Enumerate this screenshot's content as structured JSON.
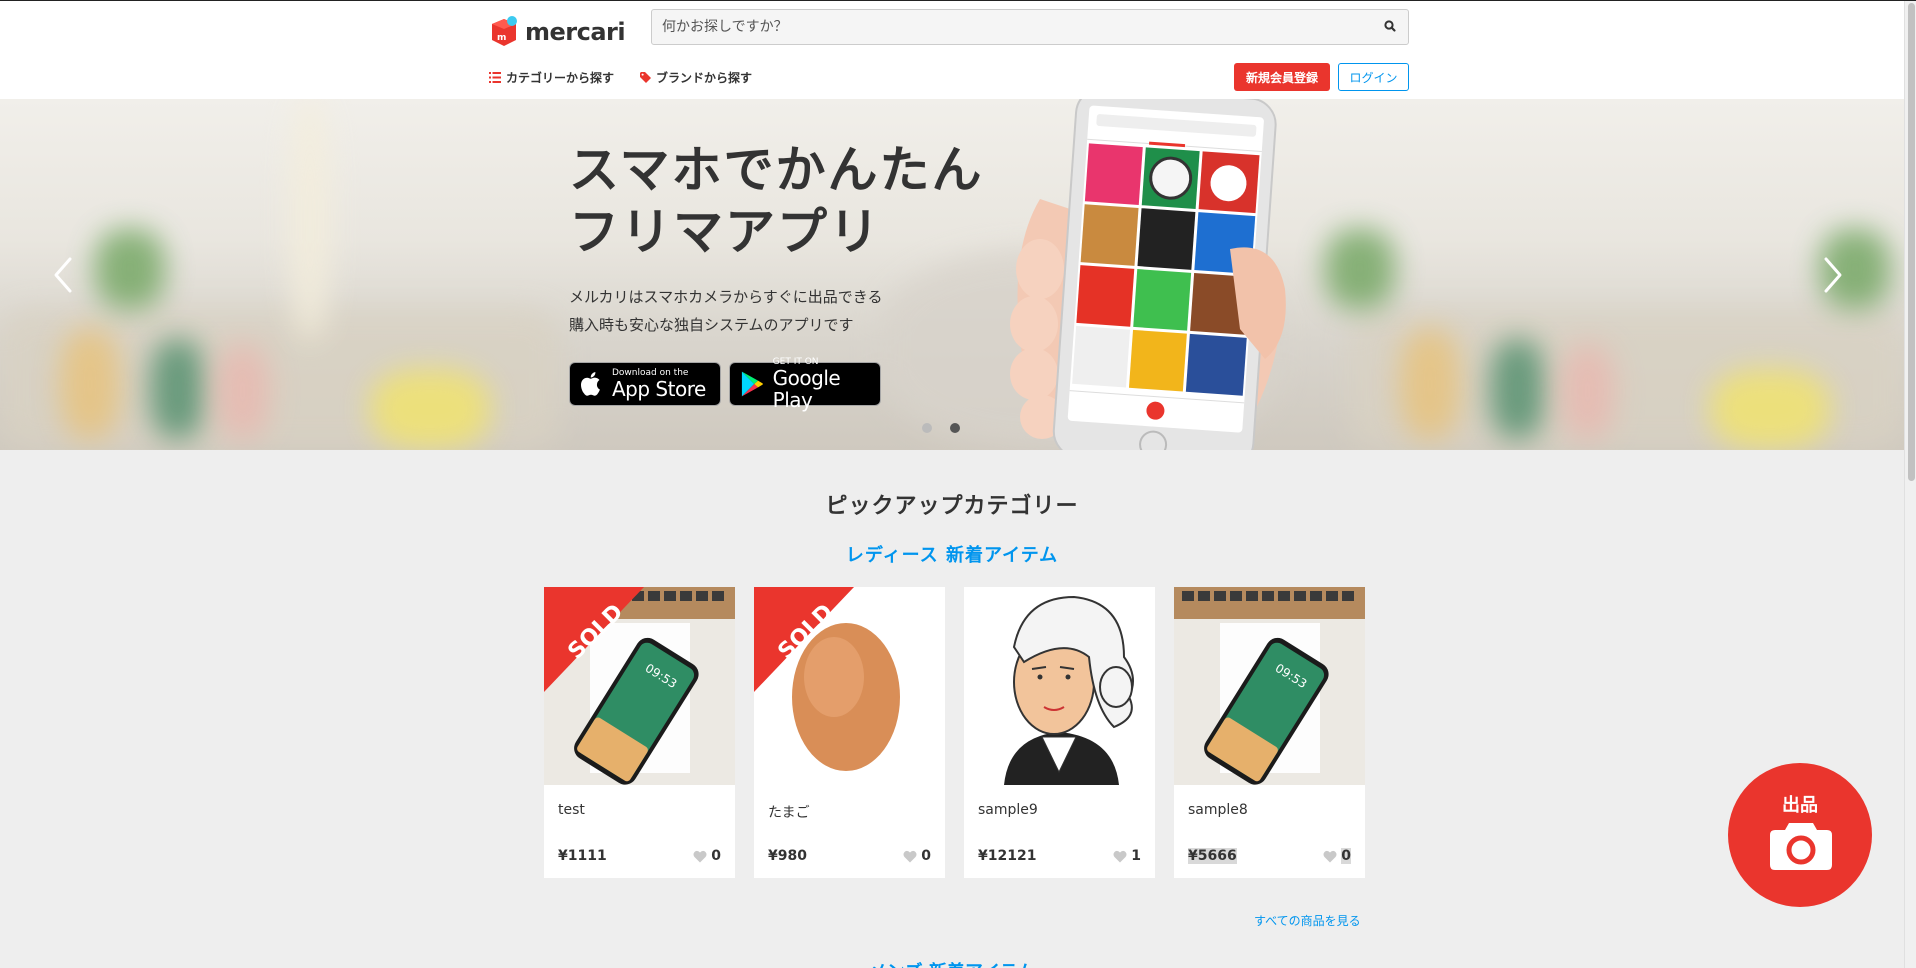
{
  "header": {
    "logo_text": "mercari",
    "search_placeholder": "何かお探しですか？",
    "nav_category": "カテゴリーから探す",
    "nav_brand": "ブランドから探す",
    "signup_label": "新規会員登録",
    "login_label": "ログイン"
  },
  "hero": {
    "title_line1": "スマホでかんたん",
    "title_line2": "フリマアプリ",
    "desc_line1": "メルカリはスマホカメラからすぐに出品できる",
    "desc_line2": "購入時も安心な独自システムのアプリです",
    "appstore_small": "Download on the",
    "appstore_big": "App Store",
    "googleplay_small": "GET IT ON",
    "googleplay_big": "Google Play",
    "active_slide": 2,
    "slide_count": 2
  },
  "pickup": {
    "title": "ピックアップカテゴリー",
    "subtitle": "レディース 新着アイテム",
    "items": [
      {
        "name": "test",
        "price": "¥1111",
        "likes": "0",
        "sold": true,
        "sold_label": "SOLD",
        "image": "iphone-x-box"
      },
      {
        "name": "たまご",
        "price": "¥980",
        "likes": "0",
        "sold": true,
        "sold_label": "SOLD",
        "image": "egg"
      },
      {
        "name": "sample9",
        "price": "¥12121",
        "likes": "1",
        "sold": false,
        "image": "portrait-illustration"
      },
      {
        "name": "sample8",
        "price": "¥5666",
        "likes": "0",
        "sold": false,
        "image": "iphone-x-box"
      }
    ],
    "see_all": "すべての商品を見る",
    "next_section_title": "メンズ 新着アイテム"
  },
  "fab": {
    "label": "出品",
    "icon": "camera-icon"
  },
  "colors": {
    "brand_red": "#ea352d",
    "link_blue": "#0095ee"
  }
}
